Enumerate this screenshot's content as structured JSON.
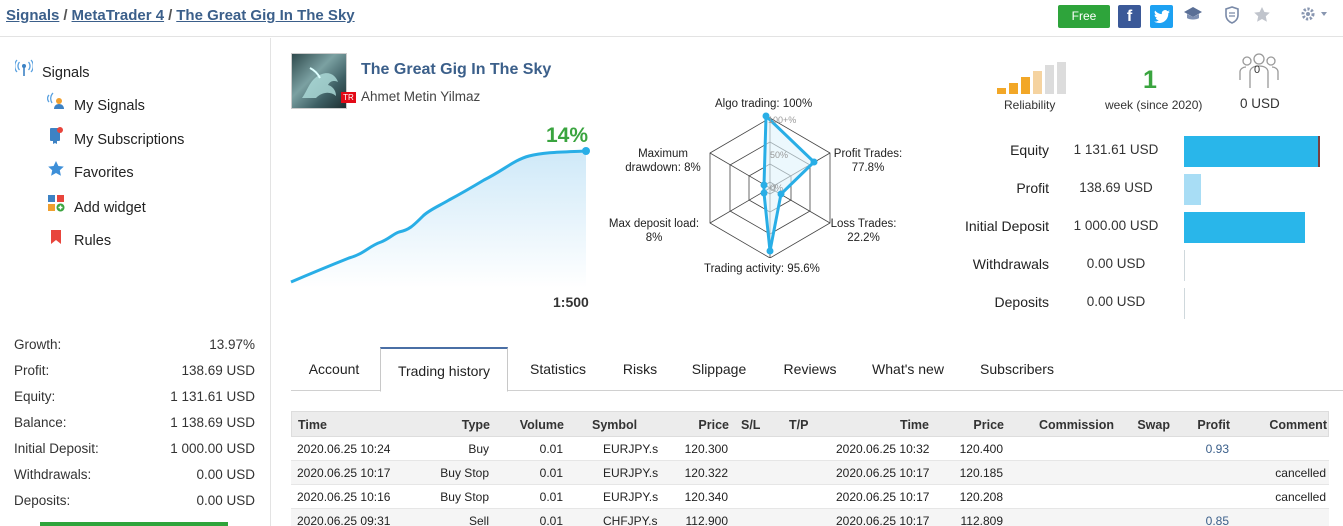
{
  "breadcrumb": {
    "item1": "Signals",
    "item2": "MetaTrader 4",
    "item3": "The Great Gig In The Sky",
    "sep": "/"
  },
  "topbar": {
    "free_label": "Free",
    "fb": "f",
    "tw": "t"
  },
  "sidebar": {
    "items": [
      {
        "label": "Signals",
        "icon": "antenna-icon"
      },
      {
        "label": "My Signals",
        "icon": "user-signal-icon"
      },
      {
        "label": "My Subscriptions",
        "icon": "subscription-icon"
      },
      {
        "label": "Favorites",
        "icon": "star-icon"
      },
      {
        "label": "Add widget",
        "icon": "widget-icon"
      },
      {
        "label": "Rules",
        "icon": "bookmark-icon"
      }
    ],
    "stats": [
      {
        "label": "Growth:",
        "value": "13.97%"
      },
      {
        "label": "Profit:",
        "value": "138.69 USD"
      },
      {
        "label": "Equity:",
        "value": "1 131.61 USD"
      },
      {
        "label": "Balance:",
        "value": "1 138.69 USD"
      },
      {
        "label": "Initial Deposit:",
        "value": "1 000.00 USD"
      },
      {
        "label": "Withdrawals:",
        "value": "0.00 USD"
      },
      {
        "label": "Deposits:",
        "value": "0.00 USD"
      }
    ]
  },
  "signal": {
    "title": "The Great Gig In The Sky",
    "author": "Ahmet Metin Yilmaz",
    "flag_country": "TR",
    "growth": "14%",
    "leverage": "1:500"
  },
  "radar": {
    "algo": "Algo trading: 100%",
    "profit_trades": "Profit Trades:",
    "profit_trades_val": "77.8%",
    "loss_trades": "Loss Trades:",
    "loss_trades_val": "22.2%",
    "activity": "Trading activity: 95.6%",
    "max_deposit": "Max deposit load:",
    "max_deposit_val": "8%",
    "max_dd": "Maximum",
    "max_dd2": "drawdown: 8%",
    "tick100": "100+%",
    "tick50": "50%",
    "tick0": "0%"
  },
  "summary": {
    "reliability_label": "Reliability",
    "weeks": "1",
    "weeks_label": "week (since 2020)",
    "subscribers_count": "0",
    "subscribers_value": "0 USD"
  },
  "metrics": [
    {
      "label": "Equity",
      "value": "1 131.61 USD",
      "fraction": 0.96,
      "color": "#29b6ea"
    },
    {
      "label": "Profit",
      "value": "138.69 USD",
      "fraction": 0.12,
      "color": "#a8ddf5"
    },
    {
      "label": "Initial Deposit",
      "value": "1 000.00 USD",
      "fraction": 0.85,
      "color": "#29b6ea"
    },
    {
      "label": "Withdrawals",
      "value": "0.00 USD",
      "fraction": 0,
      "color": "#29b6ea"
    },
    {
      "label": "Deposits",
      "value": "0.00 USD",
      "fraction": 0,
      "color": "#29b6ea"
    }
  ],
  "tabs": [
    "Account",
    "Trading history",
    "Statistics",
    "Risks",
    "Slippage",
    "Reviews",
    "What's new",
    "Subscribers"
  ],
  "table": {
    "headers": [
      "Time",
      "Type",
      "Volume",
      "Symbol",
      "Price",
      "S/L",
      "T/P",
      "Time",
      "Price",
      "Commission",
      "Swap",
      "Profit",
      "Comment"
    ],
    "rows": [
      [
        "2020.06.25 10:24",
        "Buy",
        "0.01",
        "EURJPY.s",
        "120.300",
        "",
        "",
        "2020.06.25 10:32",
        "120.400",
        "",
        "",
        "0.93",
        ""
      ],
      [
        "2020.06.25 10:17",
        "Buy Stop",
        "0.01",
        "EURJPY.s",
        "120.322",
        "",
        "",
        "2020.06.25 10:17",
        "120.185",
        "",
        "",
        "",
        "cancelled"
      ],
      [
        "2020.06.25 10:16",
        "Buy Stop",
        "0.01",
        "EURJPY.s",
        "120.340",
        "",
        "",
        "2020.06.25 10:17",
        "120.208",
        "",
        "",
        "",
        "cancelled"
      ],
      [
        "2020.06.25 09:31",
        "Sell",
        "0.01",
        "CHFJPY.s",
        "112.900",
        "",
        "",
        "2020.06.25 10:17",
        "112.809",
        "",
        "",
        "0.85",
        ""
      ]
    ]
  }
}
